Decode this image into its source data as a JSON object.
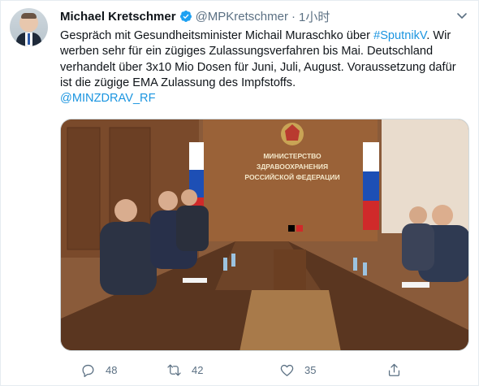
{
  "tweet": {
    "author_name": "Michael Kretschmer",
    "handle": "@MPKretschmer",
    "separator": "·",
    "time": "1小时",
    "text_lines": [
      "Gespräch mit Gesundheitsminister Michail Muraschko über ",
      "#SputnikV",
      ". Wir werben sehr für ein zügiges Zulassungsverfahren bis Mai. Deutschland verhandelt über 3x10 Mio Dosen für Juni, Juli, August. Voraussetzung dafür ist die zügige EMA Zulassung des Impfstoffs."
    ],
    "mention": "@MINZDRAV_RF",
    "photo_sign_lines": [
      "МИНИСТЕРСТВО",
      "ЗДРАВООХРАНЕНИЯ",
      "РОССИЙСКОЙ ФЕДЕРАЦИИ"
    ],
    "reply_count": "48",
    "retweet_count": "42",
    "like_count": "35"
  },
  "icons": {
    "verified": "verified-badge-icon",
    "caret": "chevron-down-icon",
    "reply": "reply-icon",
    "retweet": "retweet-icon",
    "like": "heart-icon",
    "share": "share-icon"
  },
  "colors": {
    "link": "#1b95e0",
    "secondary_text": "#5b7083",
    "verified": "#1da1f2"
  }
}
